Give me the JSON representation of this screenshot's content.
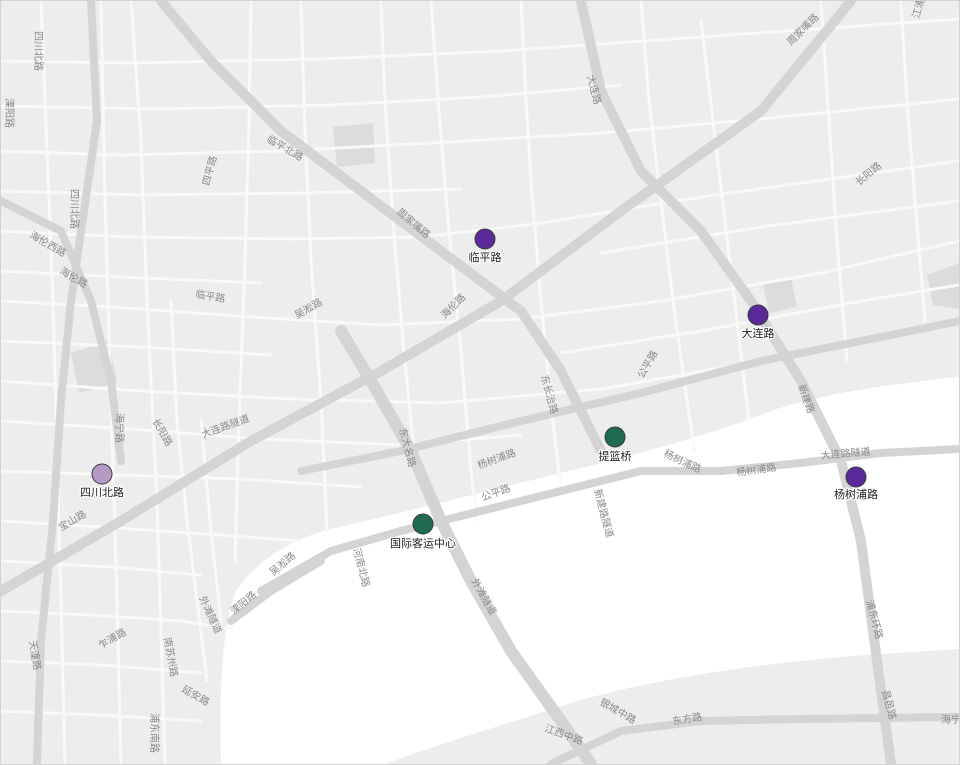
{
  "map": {
    "colors": {
      "land": "#ededed",
      "water": "#ffffff",
      "park": "#dcdcdc",
      "minor_road": "#f9f9f9",
      "major_road": "#d4d4d4",
      "label": "#8a8a8a"
    }
  },
  "stations": [
    {
      "id": "linping-lu",
      "label": "临平路",
      "color": "#5b2a9a"
    },
    {
      "id": "dalian-lu",
      "label": "大连路",
      "color": "#5b2a9a"
    },
    {
      "id": "tilanqiao",
      "label": "提篮桥",
      "color": "#1e6b52"
    },
    {
      "id": "yangshupu-lu",
      "label": "杨树浦路",
      "color": "#5b2a9a"
    },
    {
      "id": "sichuan-beilu",
      "label": "四川北路",
      "color": "#b59ac6"
    },
    {
      "id": "guoji-keyun-zhongxin",
      "label": "国际客运中心",
      "color": "#1e6b52"
    }
  ],
  "street_labels": [
    "四川北路",
    "临平北路",
    "四平路",
    "大连路",
    "周家嘴路",
    "长阳路",
    "江浦路",
    "溧阳路",
    "四川北路",
    "海伦西路",
    "海伦路",
    "临平路",
    "周家嘴路",
    "海伦路",
    "吴淞路",
    "长阳路",
    "公平路",
    "东长治路",
    "杨树浦路",
    "杨树浦路",
    "杨树浦路",
    "大连路隧道",
    "新建路",
    "东大名路",
    "公平路",
    "新建路隧道",
    "外滩隧道",
    "吴淞路",
    "外滩隧道",
    "溧阳路",
    "河南北路",
    "天潼路",
    "乍浦路",
    "南苏州路",
    "延安路",
    "浦东南路",
    "银城中路",
    "东方路",
    "昌邑路",
    "海宁路",
    "大连路隧道",
    "浦东环路",
    "江西中路",
    "海宁路",
    "宝山路",
    "四川北路"
  ]
}
